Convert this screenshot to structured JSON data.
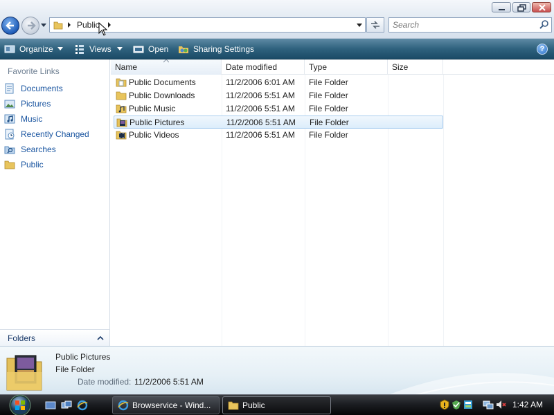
{
  "window": {
    "controls": {
      "minimize": "minimize-icon",
      "maximize": "maximize-icon",
      "close": "close-icon"
    }
  },
  "navigation": {
    "address": "Public",
    "search_placeholder": "Search"
  },
  "toolbar": {
    "organize": "Organize",
    "views": "Views",
    "open": "Open",
    "sharing": "Sharing Settings",
    "help": "?"
  },
  "sidebar": {
    "heading": "Favorite Links",
    "items": [
      {
        "label": "Documents",
        "icon": "documents-icon"
      },
      {
        "label": "Pictures",
        "icon": "pictures-icon"
      },
      {
        "label": "Music",
        "icon": "music-icon"
      },
      {
        "label": "Recently Changed",
        "icon": "recently-changed-icon"
      },
      {
        "label": "Searches",
        "icon": "searches-icon"
      },
      {
        "label": "Public",
        "icon": "folder-icon"
      }
    ],
    "folders_label": "Folders"
  },
  "filelist": {
    "columns": [
      "Name",
      "Date modified",
      "Type",
      "Size"
    ],
    "rows": [
      {
        "name": "Public Documents",
        "date": "11/2/2006 6:01 AM",
        "type": "File Folder",
        "size": ""
      },
      {
        "name": "Public Downloads",
        "date": "11/2/2006 5:51 AM",
        "type": "File Folder",
        "size": ""
      },
      {
        "name": "Public Music",
        "date": "11/2/2006 5:51 AM",
        "type": "File Folder",
        "size": ""
      },
      {
        "name": "Public Pictures",
        "date": "11/2/2006 5:51 AM",
        "type": "File Folder",
        "size": "",
        "selected": true
      },
      {
        "name": "Public Videos",
        "date": "11/2/2006 5:51 AM",
        "type": "File Folder",
        "size": ""
      }
    ]
  },
  "details": {
    "name": "Public Pictures",
    "type": "File Folder",
    "date_label": "Date modified:",
    "date_value": "11/2/2006 5:51 AM"
  },
  "taskbar": {
    "tasks": [
      {
        "label": "Browservice - Wind...",
        "icon": "internet-explorer-icon"
      },
      {
        "label": "Public",
        "icon": "folder-icon"
      }
    ],
    "clock": "1:42 AM"
  },
  "colors": {
    "accent": "#1a55a0",
    "command_bar": "#2f627e",
    "selection": "#dcedfb"
  }
}
